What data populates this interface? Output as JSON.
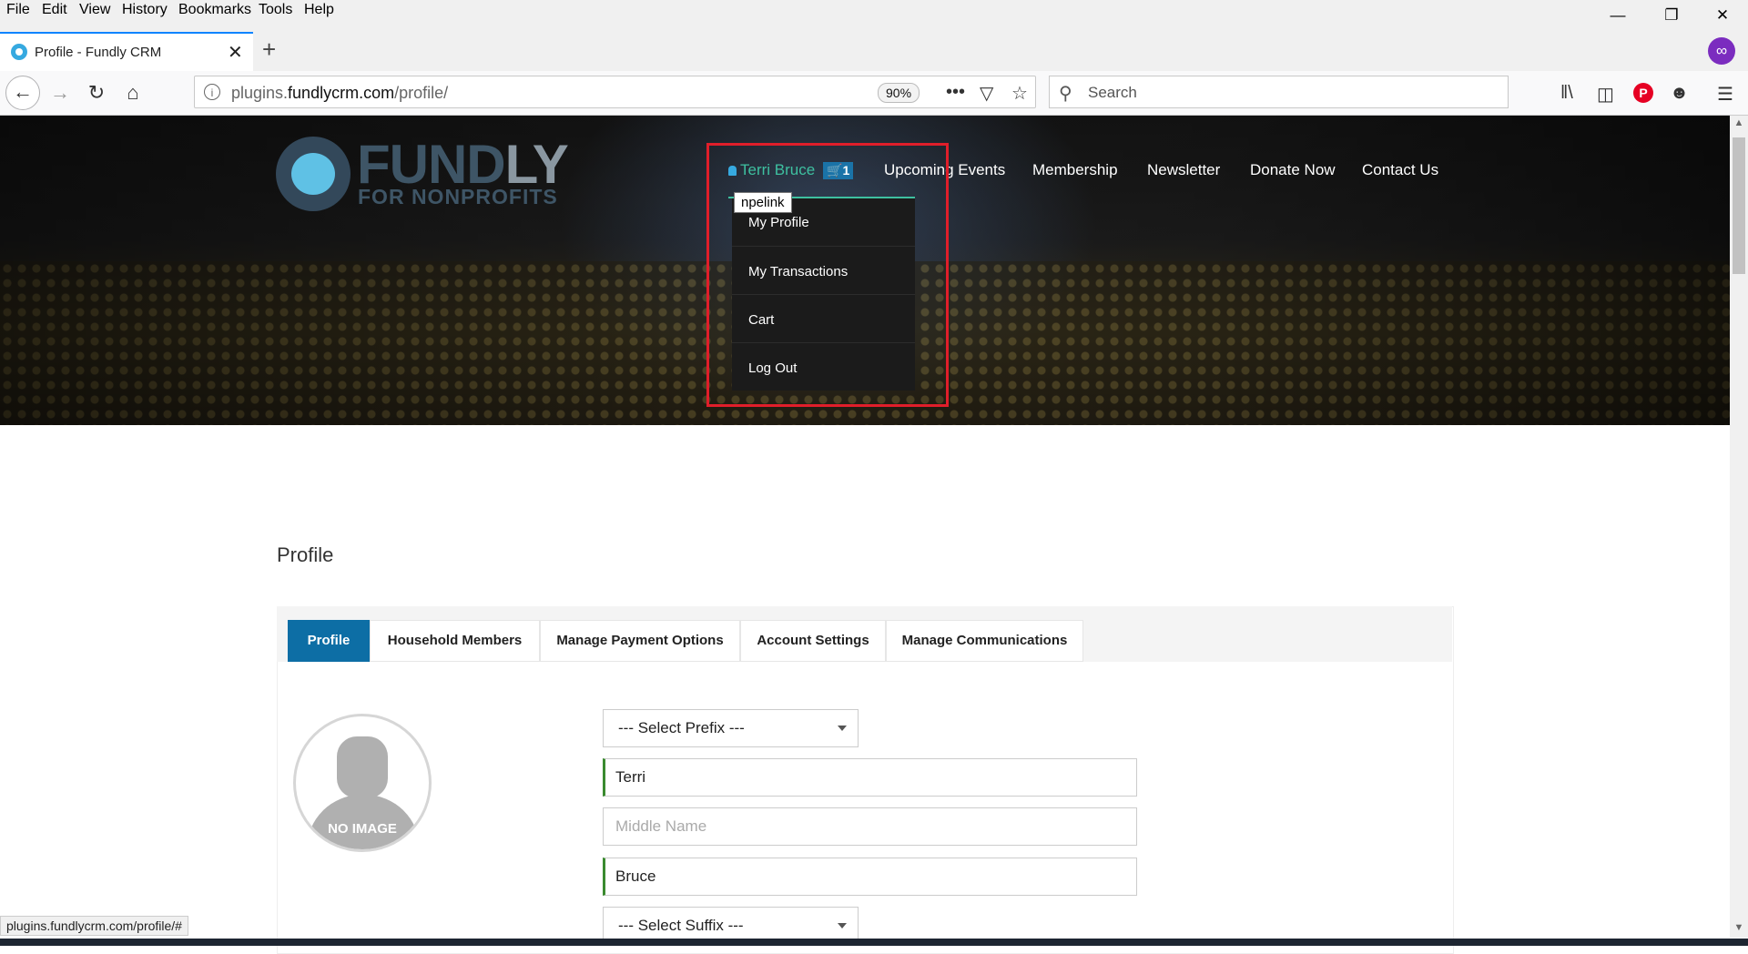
{
  "menubar": {
    "items": [
      "File",
      "Edit",
      "View",
      "History",
      "Bookmarks",
      "Tools",
      "Help"
    ],
    "shortcuts": [
      "F",
      "E",
      "V",
      "S",
      "B",
      "T",
      "H"
    ]
  },
  "browser": {
    "tab_title": "Profile - Fundly CRM",
    "url_plain_prefix": "plugins.",
    "url_domain": "fundlycrm.com",
    "url_path": "/profile/",
    "zoom": "90%",
    "search_placeholder": "Search",
    "status_url": "plugins.fundlycrm.com/profile/#"
  },
  "site": {
    "logo_main": "FUND",
    "logo_accent": "LY",
    "logo_sub": "FOR NONPROFITS",
    "user_name": "Terri Bruce",
    "cart_count": "1",
    "nav": [
      "Upcoming Events",
      "Membership",
      "Newsletter",
      "Donate Now",
      "Contact Us"
    ],
    "tooltip": "npelink",
    "dropdown": [
      "My Profile",
      "My Transactions",
      "Cart",
      "Log Out"
    ]
  },
  "page": {
    "title": "Profile",
    "tabs": [
      "Profile",
      "Household Members",
      "Manage Payment Options",
      "Account Settings",
      "Manage Communications"
    ],
    "avatar_text": "NO IMAGE",
    "form": {
      "prefix": "--- Select Prefix ---",
      "first_name": "Terri",
      "middle_placeholder": "Middle Name",
      "last_name": "Bruce",
      "suffix": "--- Select Suffix ---"
    }
  },
  "colors": {
    "accent": "#0d6ea5",
    "highlight": "#e01e2a",
    "user_link": "#3ec0a0"
  }
}
